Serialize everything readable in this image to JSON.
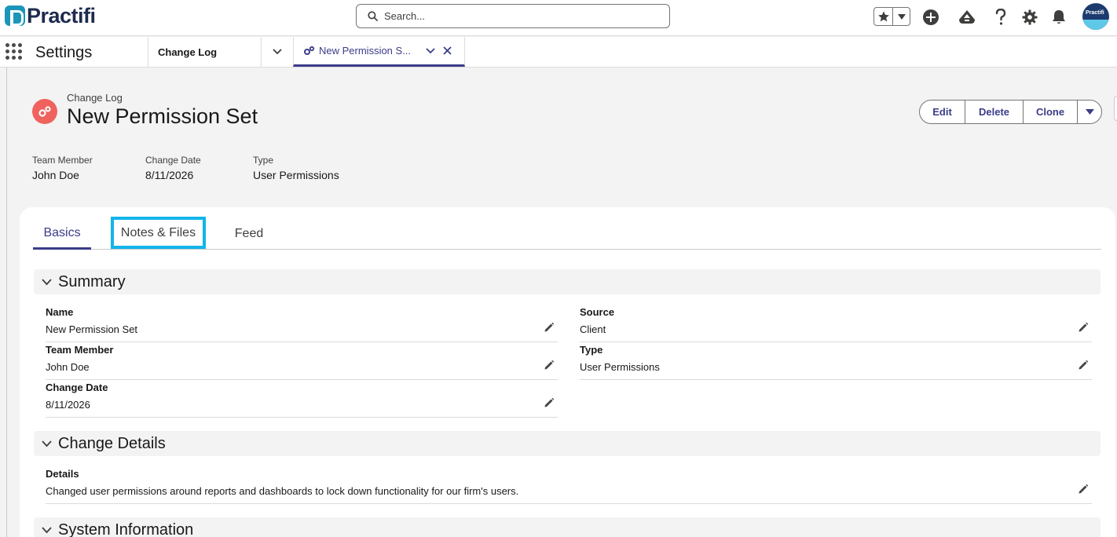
{
  "header": {
    "logo_text": "Practifi",
    "search_placeholder": "Search...",
    "avatar_text": "Practifi"
  },
  "nav": {
    "app_name": "Settings",
    "tabs": [
      {
        "label": "Change Log"
      },
      {
        "label": "New Permission S..."
      }
    ]
  },
  "record": {
    "object_type": "Change Log",
    "title": "New Permission Set",
    "actions": {
      "edit": "Edit",
      "delete": "Delete",
      "clone": "Clone"
    },
    "highlights": [
      {
        "label": "Team Member",
        "value": "John Doe"
      },
      {
        "label": "Change Date",
        "value": "8/11/2026"
      },
      {
        "label": "Type",
        "value": "User Permissions"
      }
    ]
  },
  "tabs": {
    "basics": "Basics",
    "notes": "Notes & Files",
    "feed": "Feed"
  },
  "sections": {
    "summary": {
      "title": "Summary",
      "fields": {
        "name": {
          "label": "Name",
          "value": "New Permission Set"
        },
        "team_member": {
          "label": "Team Member",
          "value": "John Doe"
        },
        "change_date": {
          "label": "Change Date",
          "value": "8/11/2026"
        },
        "source": {
          "label": "Source",
          "value": "Client"
        },
        "type": {
          "label": "Type",
          "value": "User Permissions"
        }
      }
    },
    "change_details": {
      "title": "Change Details",
      "fields": {
        "details": {
          "label": "Details",
          "value": "Changed user permissions around reports and dashboards to lock down functionality for our firm's users."
        }
      }
    },
    "system_information": {
      "title": "System Information"
    }
  },
  "colors": {
    "brand": "#3b3c89",
    "record_icon": "#f0625d",
    "highlight_box": "#12b5ea"
  }
}
